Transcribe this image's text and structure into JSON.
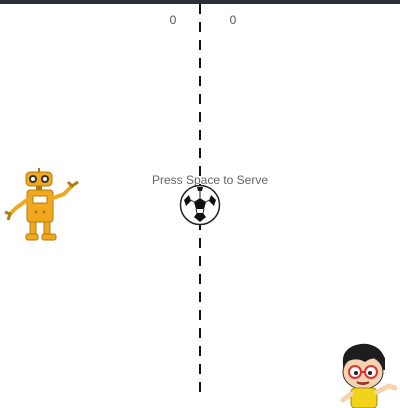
{
  "scores": {
    "left": "0",
    "right": "0"
  },
  "prompt": "Press Space to Serve",
  "icons": {
    "ball": "soccer-ball-icon",
    "left_player": "robot-icon",
    "right_player": "kid-icon"
  },
  "colors": {
    "topbar": "#2b3036",
    "robot": "#f2a81d",
    "line": "#111111",
    "score_text": "#555555"
  }
}
